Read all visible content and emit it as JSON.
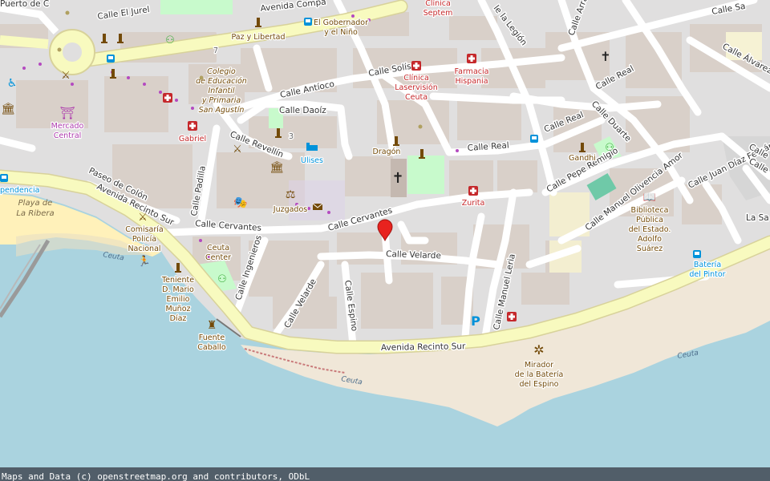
{
  "map": {
    "attribution": "Maps and Data (c) openstreetmap.org and contributors, ODbL",
    "colors": {
      "sea": "#aad3df",
      "land": "#e0dfdf",
      "building": "#d9d0c9",
      "primary_road": "#f8fabf",
      "minor_road": "#ffffff",
      "beach": "#fff1ba",
      "park": "#c8facc",
      "marker": "#e8231f"
    },
    "streets": {
      "avenida_recinto_sur_west": "Avenida Recinto Sur",
      "avenida_recinto_sur_south": "Avenida Recinto Sur",
      "avenida_compania": "Avenida Compa",
      "calle_el_jurel": "Calle El Jurel",
      "puerto_de_ceuta": "Puerto de C",
      "calle_solis": "Calle Solís",
      "calle_antioco": "Calle Antíoco",
      "calle_daoiz": "Calle Daoíz",
      "calle_revellin": "Calle Revellín",
      "calle_padilla": "Calle Padilla",
      "paseo_de_colon": "Paseo de Colón",
      "calle_cervantes_west": "Calle Cervantes",
      "calle_cervantes_east": "Calle Cervantes",
      "calle_velarde": "Calle Velarde",
      "calle_velarde_diag": "Calle Velarde",
      "calle_ingenieros": "Calle Ingenieros",
      "calle_espino": "Calle Espino",
      "calle_manuel_leria": "Calle Manuel Leria",
      "calle_real_1": "Calle Real",
      "calle_real_2": "Calle Real",
      "calle_real_3": "Calle Real",
      "calle_duarte": "Calle Duarte",
      "calle_pepe_remigio": "Calle Pepe Remigio",
      "calle_manuel_olivencia_amor": "Calle Manuel Olivencia Amor",
      "calle_juan_diaz_fernandez": "Calle Juan Díaz Fernández",
      "calle_alvarez": "Calle Álvarez",
      "calle_arrabal": "Calle Arrabal",
      "calle_la_legion": "le la Legión",
      "calle_top_right": "Calle Sa",
      "calle_right_1": "Calle",
      "calle_right_2": "Calle",
      "calle_la_sa": "La Sa"
    },
    "pois": {
      "clinica_septem": "Clínica Septem",
      "el_gobernador": "El Gobernador y el Niño",
      "paz_y_libertad": "Paz y Libertad",
      "colegio": "Colegio de Educación Infantil y Primaria San Agustín",
      "clinica_laservision": "Clínica Laservisión Ceuta",
      "farmacia_hispania": "Farmacia Hispania",
      "mercado_central": "Mercado Central",
      "gabriel": "Gabriel",
      "dragon": "Dragón",
      "ulises": "Ulises",
      "juzgados": "Juzgados",
      "zurita": "Zurita",
      "gandhi": "Gandhi",
      "biblioteca": "Biblioteca Pública del Estado. Adolfo Suárez",
      "bateria_del_pintor": "Batería del Pintor",
      "ceuta_center": "Ceuta Center",
      "comisaria": "Comisaría Policía Nacional",
      "teniente": "Teniente D. Mario Emilio Muñoz Díaz",
      "fuente_caballo": "Fuente Caballo",
      "mirador": "Mirador de la Batería del Espino",
      "playa_la_ribera": "Playa de La Ribera",
      "independencia": "pendencia",
      "number_7": "7",
      "number_3": "3"
    },
    "water_labels": {
      "ceuta_1": "Ceuta",
      "ceuta_2": "Ceuta",
      "ceuta_3": "Ceuta"
    }
  }
}
